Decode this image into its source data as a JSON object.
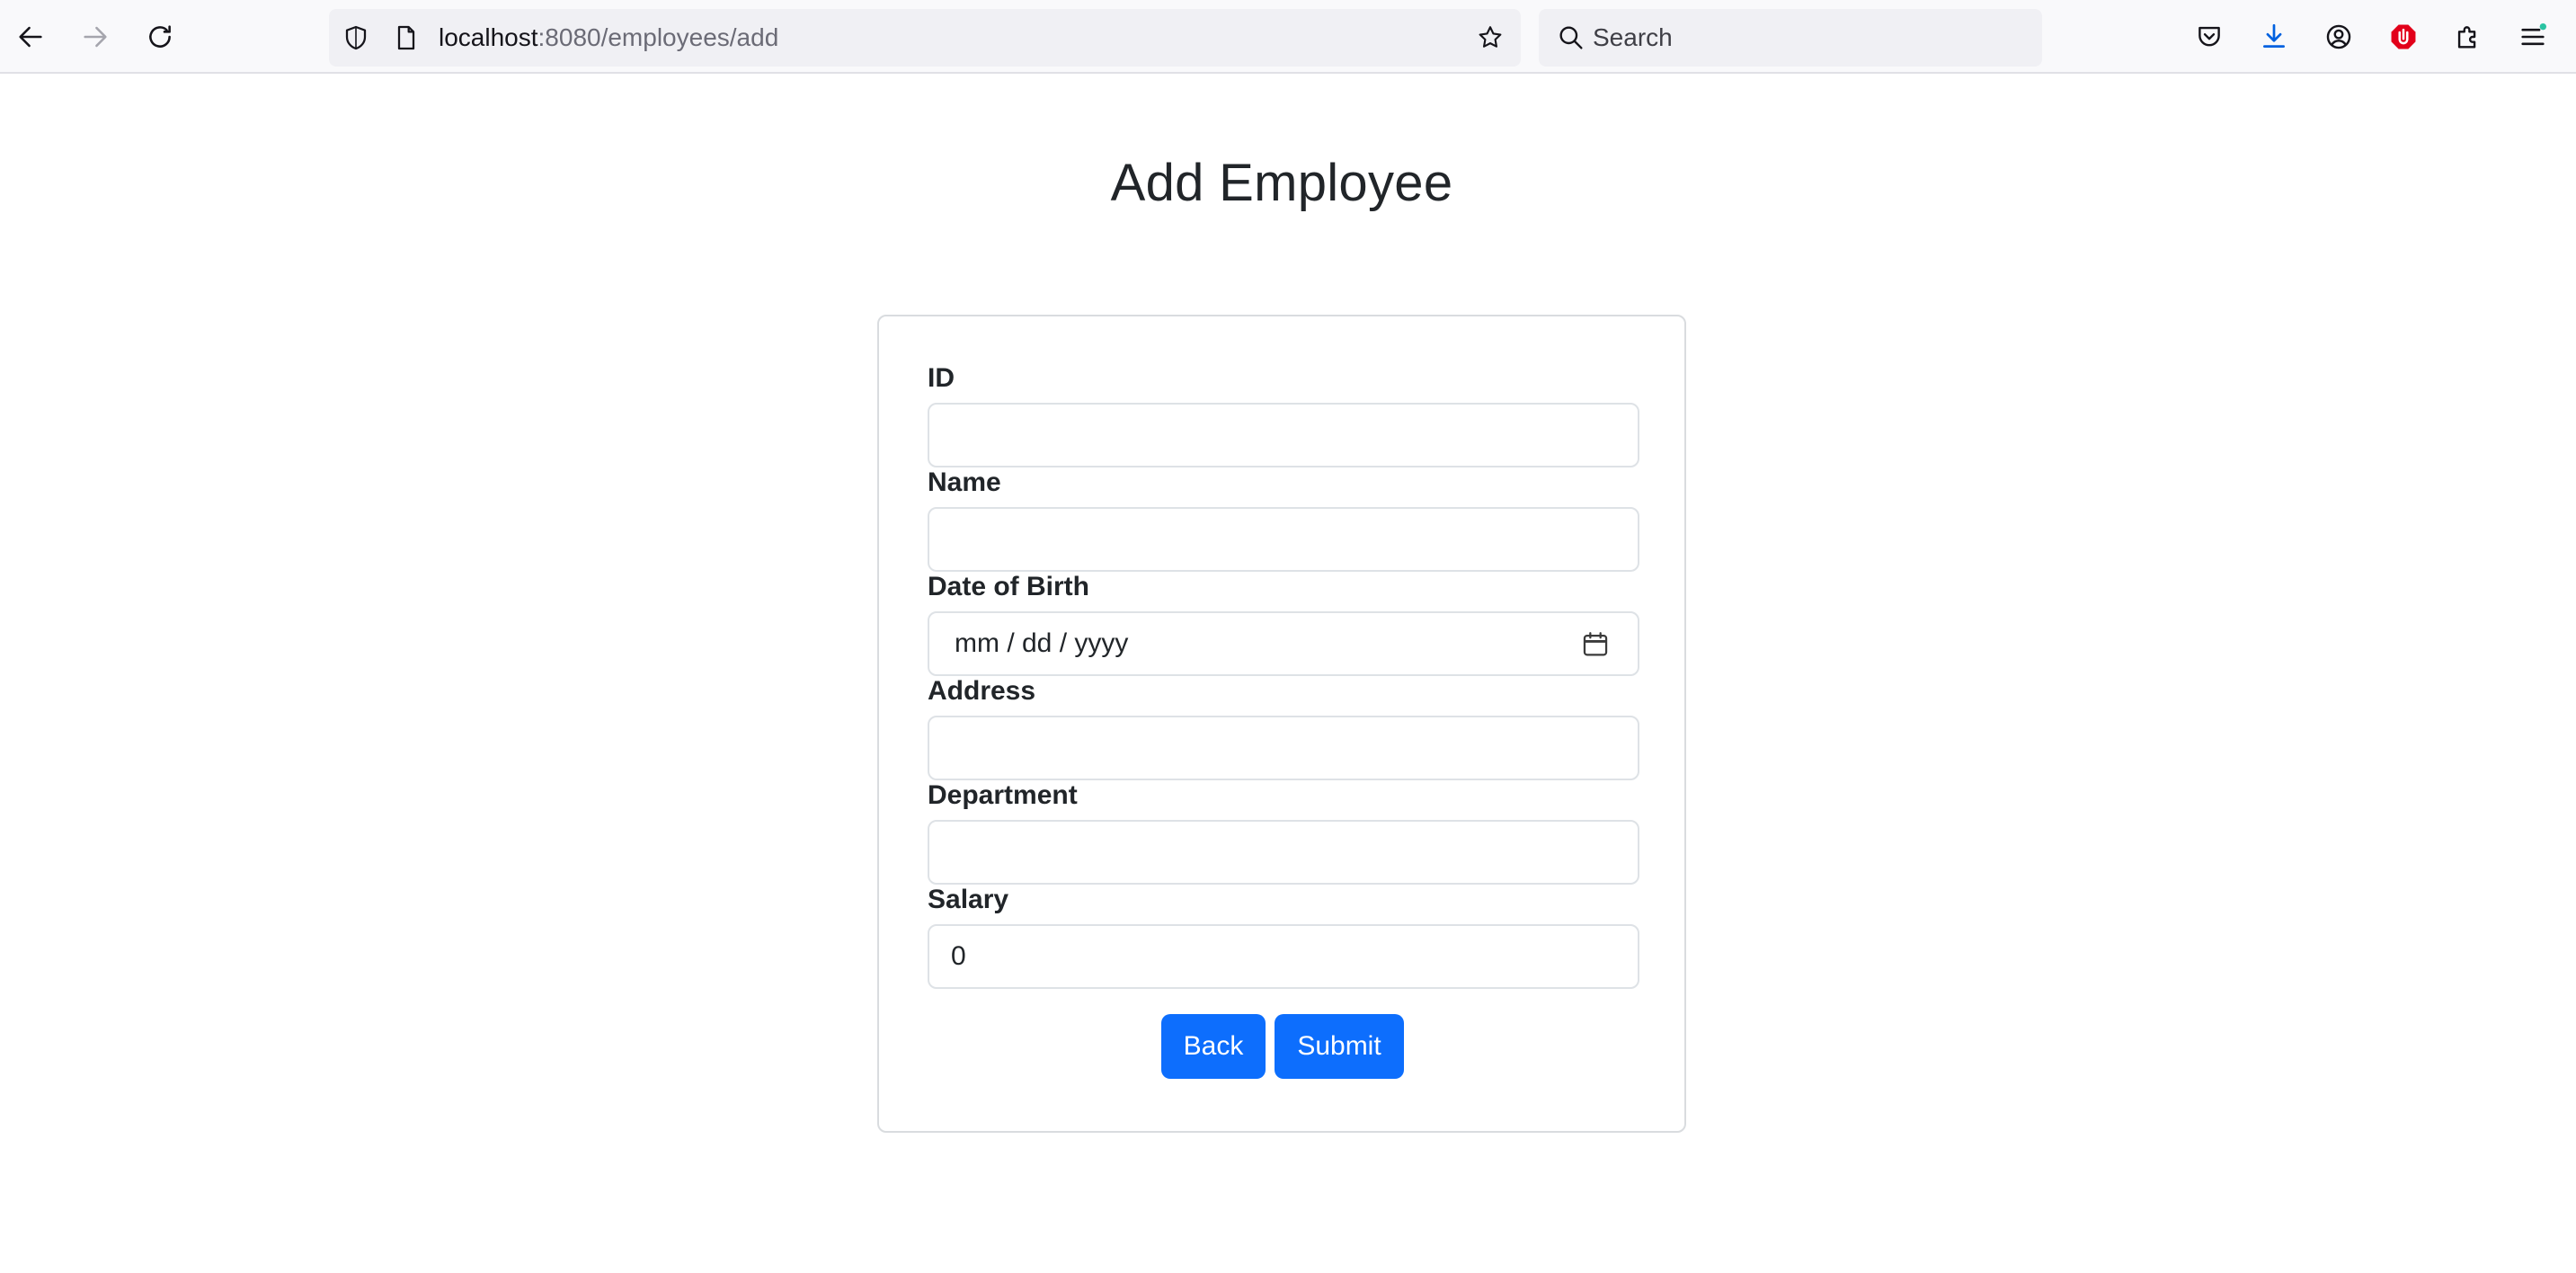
{
  "browser": {
    "url_host": "localhost",
    "url_rest": ":8080/employees/add",
    "search_placeholder": "Search"
  },
  "page": {
    "title": "Add Employee"
  },
  "form": {
    "id_label": "ID",
    "id_value": "",
    "name_label": "Name",
    "name_value": "",
    "dob_label": "Date of Birth",
    "dob_placeholder": "mm / dd / yyyy",
    "address_label": "Address",
    "address_value": "",
    "department_label": "Department",
    "department_value": "",
    "salary_label": "Salary",
    "salary_value": "0"
  },
  "buttons": {
    "back": "Back",
    "submit": "Submit"
  },
  "colors": {
    "primary": "#0d6efd",
    "toolbar_bg": "#f9f9fb",
    "urlbar_bg": "#f0f0f4",
    "download_accent": "#0061e0",
    "ublock_red": "#e2001a",
    "notification_dot": "#2ac3a2"
  }
}
